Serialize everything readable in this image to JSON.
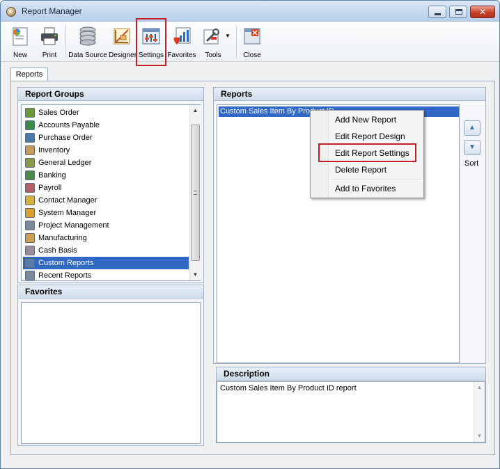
{
  "window": {
    "title": "Report Manager",
    "minimize_glyph": "",
    "maximize_glyph": "",
    "close_glyph": "✕"
  },
  "toolbar": {
    "new_label": "New",
    "print_label": "Print",
    "data_source_label": "Data Source",
    "designer_label": "Designer",
    "settings_label": "Settings",
    "favorites_label": "Favorites",
    "tools_label": "Tools",
    "close_label": "Close",
    "dropdown_glyph": "▼"
  },
  "tabs": [
    {
      "label": "Reports"
    }
  ],
  "report_groups": {
    "header": "Report Groups",
    "items": [
      {
        "label": "Sales Order",
        "icon": "sales-order-icon",
        "color": "#6a9a3a"
      },
      {
        "label": "Accounts Payable",
        "icon": "accounts-payable-icon",
        "color": "#3a8a4a"
      },
      {
        "label": "Purchase Order",
        "icon": "purchase-order-icon",
        "color": "#4a7aa8"
      },
      {
        "label": "Inventory",
        "icon": "inventory-icon",
        "color": "#c89a60"
      },
      {
        "label": "General Ledger",
        "icon": "general-ledger-icon",
        "color": "#8a9a4a"
      },
      {
        "label": "Banking",
        "icon": "banking-icon",
        "color": "#4a8a4a"
      },
      {
        "label": "Payroll",
        "icon": "payroll-icon",
        "color": "#b8606a"
      },
      {
        "label": "Contact Manager",
        "icon": "contact-manager-icon",
        "color": "#d8b040"
      },
      {
        "label": "System Manager",
        "icon": "system-manager-icon",
        "color": "#d8a030"
      },
      {
        "label": "Project Management",
        "icon": "project-management-icon",
        "color": "#7a8a9a"
      },
      {
        "label": "Manufacturing",
        "icon": "manufacturing-icon",
        "color": "#c8a050"
      },
      {
        "label": "Cash Basis",
        "icon": "cash-basis-icon",
        "color": "#9a8aa0"
      },
      {
        "label": "Custom Reports",
        "icon": "custom-reports-icon",
        "color": "#5a7aa8"
      },
      {
        "label": "Recent Reports",
        "icon": "recent-reports-icon",
        "color": "#7a8a9a"
      }
    ],
    "selected_index": 12
  },
  "favorites": {
    "header": "Favorites"
  },
  "reports": {
    "header": "Reports",
    "items": [
      {
        "label": "Custom Sales Item By Product ID"
      }
    ],
    "sort_label": "Sort",
    "sort_up_glyph": "▲",
    "sort_down_glyph": "▼"
  },
  "context_menu": {
    "items": [
      {
        "label": "Add New Report"
      },
      {
        "label": "Edit Report Design"
      },
      {
        "label": "Edit Report Settings"
      },
      {
        "label": "Delete Report"
      },
      {
        "label": "Add to Favorites"
      }
    ]
  },
  "description": {
    "header": "Description",
    "text": "Custom Sales Item By Product ID report"
  },
  "scrollbar": {
    "up_glyph": "▲",
    "down_glyph": "▼"
  },
  "colors": {
    "selection": "#3168c6",
    "highlight_box": "#c0202a"
  }
}
